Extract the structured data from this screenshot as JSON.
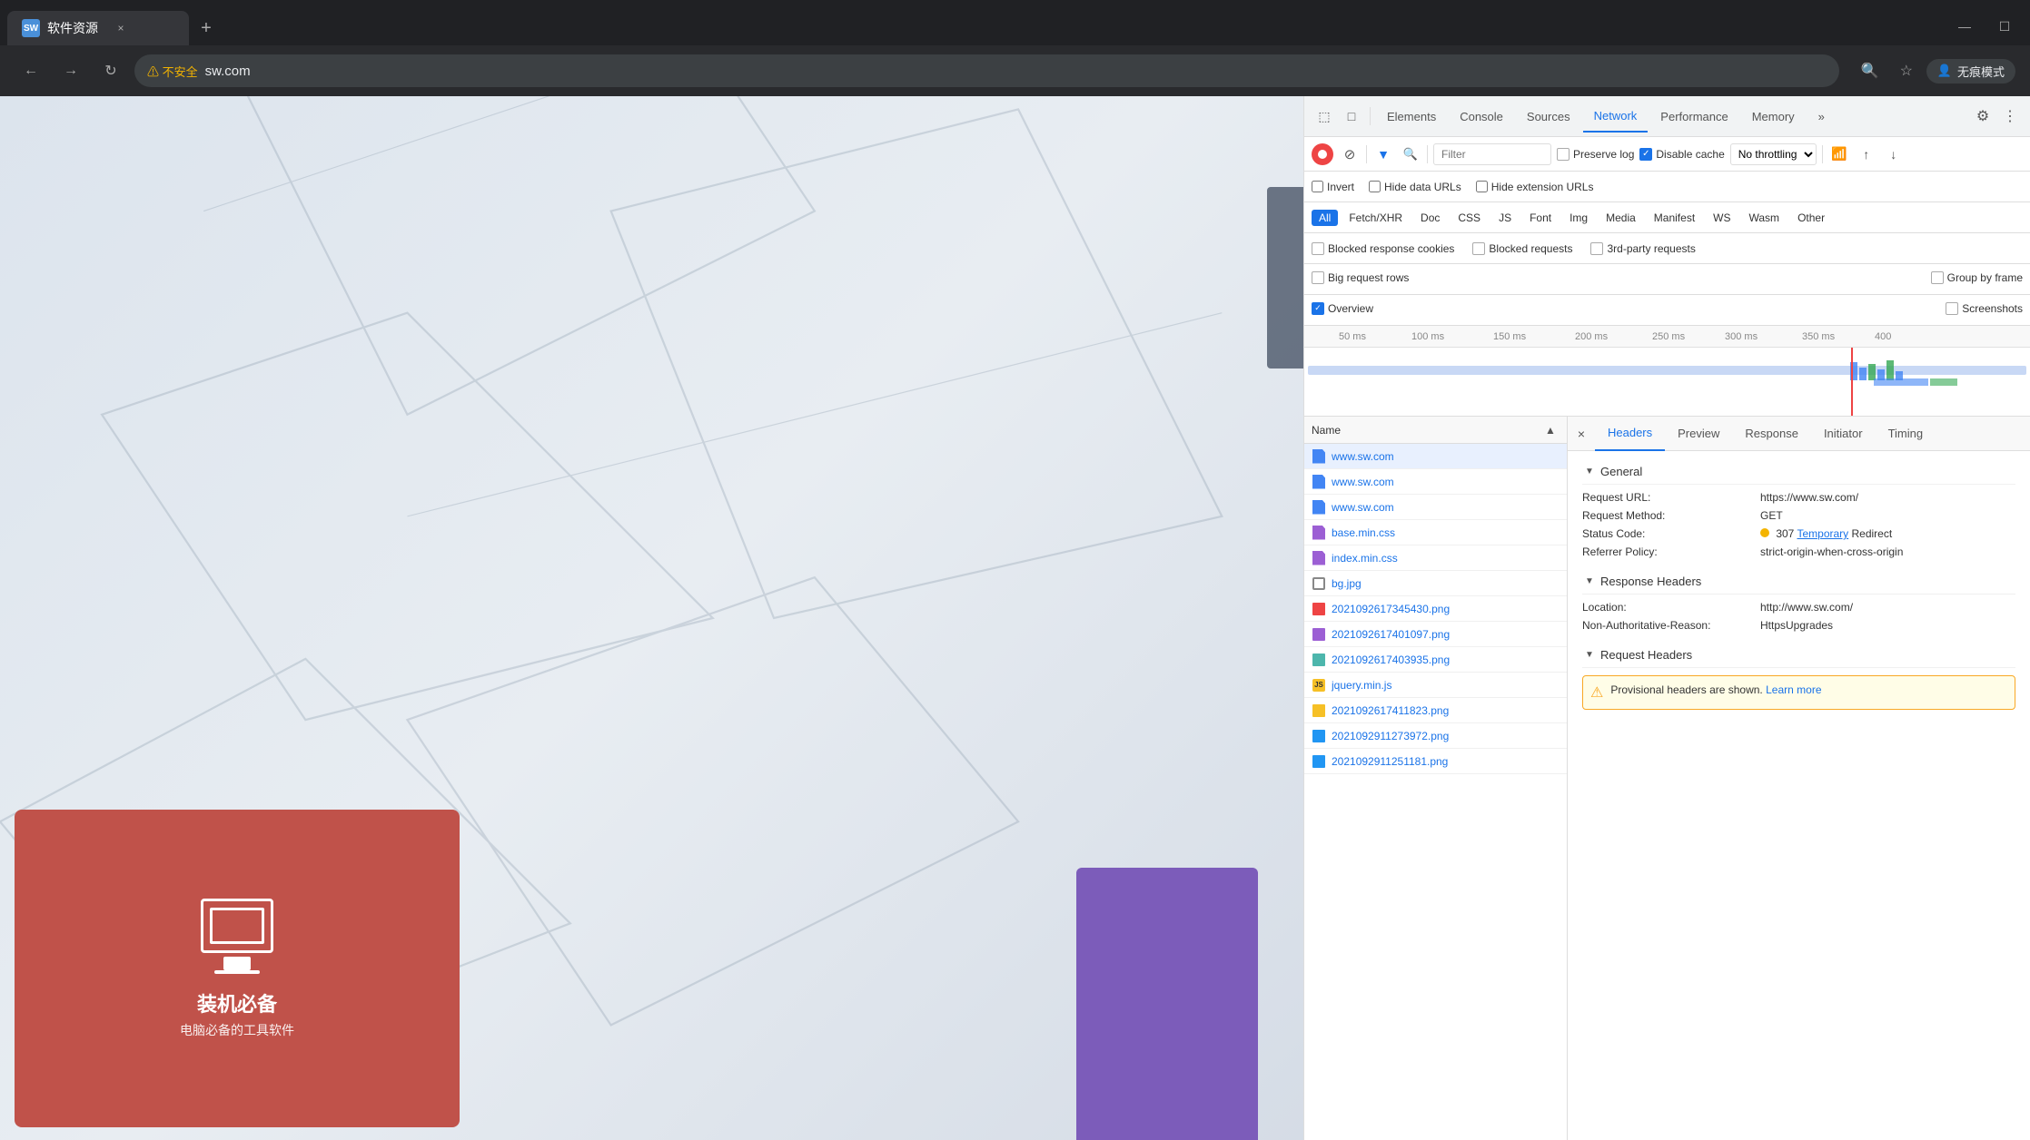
{
  "browser": {
    "tab_favicon": "SW",
    "tab_title": "软件资源",
    "tab_close": "×",
    "tab_new": "+",
    "win_minimize": "—",
    "win_maximize": "☐",
    "nav_back": "←",
    "nav_forward": "→",
    "nav_refresh": "↻",
    "address_warning": "⚠ 不安全",
    "address_url": "sw.com",
    "incognito_label": "无痕模式"
  },
  "devtools": {
    "tools": [
      "⬚",
      "□"
    ],
    "tabs": [
      "Elements",
      "Console",
      "Sources",
      "Network",
      "Performance",
      "Memory"
    ],
    "active_tab": "Network",
    "more_tabs": "»",
    "settings_icon": "⚙",
    "more_icon": "⋮",
    "toolbar": {
      "record_label": "record",
      "clear_label": "clear",
      "filter_label": "filter",
      "search_label": "search",
      "filter_placeholder": "Filter",
      "preserve_cache_label": "Preserve log",
      "disable_cache_label": "Disable cache",
      "throttle_label": "No throttling",
      "import_icon": "↑",
      "export_icon": "↓",
      "invert_label": "Invert",
      "hide_data_label": "Hide data URLs",
      "hide_ext_label": "Hide extension URLs"
    },
    "type_filters": [
      "All",
      "Fetch/XHR",
      "Doc",
      "CSS",
      "JS",
      "Font",
      "Img",
      "Media",
      "Manifest",
      "WS",
      "Wasm",
      "Other"
    ],
    "active_type": "All",
    "options": [
      "Blocked response cookies",
      "Blocked requests",
      "3rd-party requests",
      "Big request rows",
      "Group by frame",
      "Overview",
      "Screenshots"
    ],
    "timeline": {
      "marks": [
        "50 ms",
        "100 ms",
        "150 ms",
        "200 ms",
        "250 ms",
        "300 ms",
        "350 ms",
        "400"
      ]
    }
  },
  "network_list": {
    "column_name": "Name",
    "items": [
      {
        "name": "www.sw.com",
        "type": "doc",
        "selected": true
      },
      {
        "name": "www.sw.com",
        "type": "doc",
        "selected": false
      },
      {
        "name": "www.sw.com",
        "type": "doc",
        "selected": false
      },
      {
        "name": "base.min.css",
        "type": "css",
        "selected": false
      },
      {
        "name": "index.min.css",
        "type": "css",
        "selected": false
      },
      {
        "name": "bg.jpg",
        "type": "img",
        "selected": false
      },
      {
        "name": "2021092617345430.png",
        "type": "png-red",
        "selected": false
      },
      {
        "name": "2021092617401097.png",
        "type": "png-purple",
        "selected": false
      },
      {
        "name": "2021092617403935.png",
        "type": "png-teal",
        "selected": false
      },
      {
        "name": "jquery.min.js",
        "type": "js",
        "selected": false
      },
      {
        "name": "2021092617411823.png",
        "type": "png-yellow",
        "selected": false
      },
      {
        "name": "2021092911273972.png",
        "type": "png-blue",
        "selected": false
      },
      {
        "name": "2021092911251181.png",
        "type": "png-blue",
        "selected": false
      }
    ]
  },
  "detail": {
    "close_label": "×",
    "tabs": [
      "Headers",
      "Preview",
      "Response",
      "Initiator",
      "Timing"
    ],
    "active_tab": "Headers",
    "general": {
      "section_label": "General",
      "request_url_key": "Request URL:",
      "request_url_val": "https://www.sw.com/",
      "request_method_key": "Request Method:",
      "request_method_val": "GET",
      "status_code_key": "Status Code:",
      "status_code_val": "307 Temporary Redirect",
      "status_code_highlight": "Temporary",
      "referrer_policy_key": "Referrer Policy:",
      "referrer_policy_val": "strict-origin-when-cross-origin"
    },
    "response_headers": {
      "section_label": "Response Headers",
      "location_key": "Location:",
      "location_val": "http://www.sw.com/",
      "non_auth_key": "Non-Authoritative-Reason:",
      "non_auth_val": "HttpsUpgrades"
    },
    "request_headers": {
      "section_label": "Request Headers",
      "warning_text": "Provisional headers are shown.",
      "learn_more": "Learn more"
    }
  },
  "webpage": {
    "card_title": "装机必备",
    "card_subtitle": "电脑必备的工具软件"
  }
}
